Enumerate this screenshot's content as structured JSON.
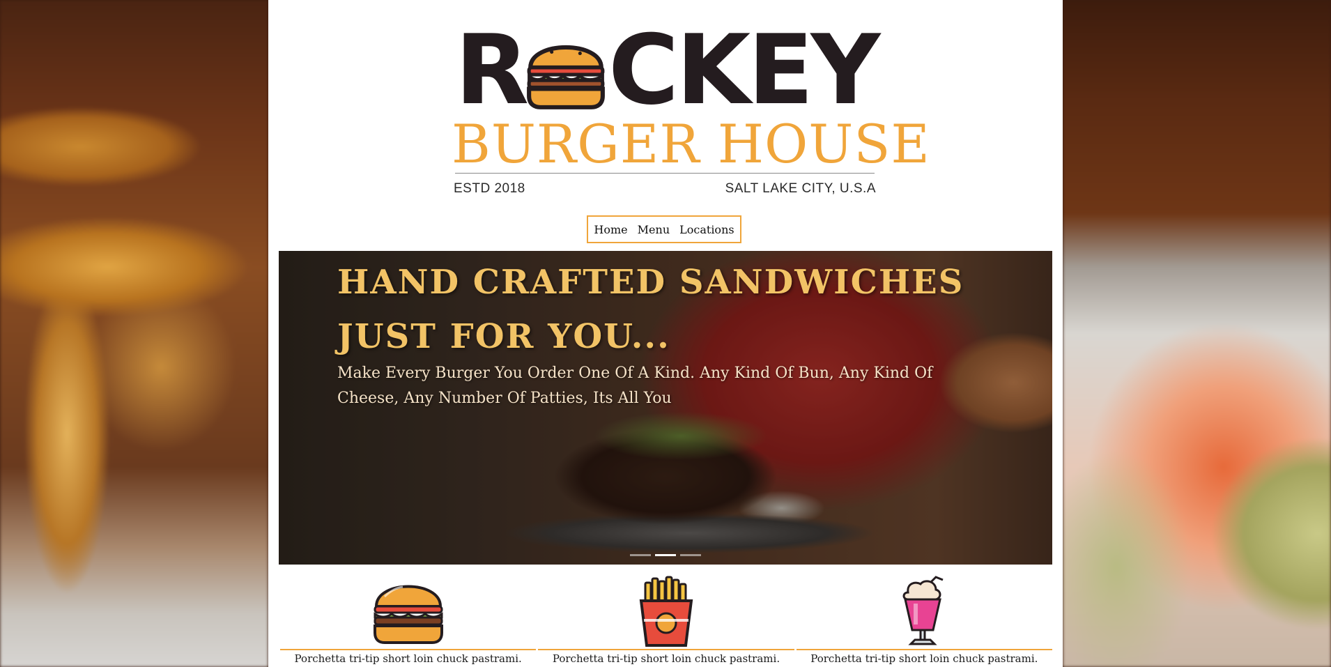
{
  "brand": {
    "name_top_first": "R",
    "name_top_rest": "CKEY",
    "name_sub": "BURGER HOUSE",
    "established": "ESTD 2018",
    "location": "SALT LAKE CITY, U.S.A"
  },
  "nav": {
    "items": [
      {
        "label": "Home"
      },
      {
        "label": "Menu"
      },
      {
        "label": "Locations"
      }
    ]
  },
  "hero": {
    "title": "HAND CRAFTED SANDWICHES JUST FOR YOU...",
    "subtitle": "Make Every Burger You Order One Of A Kind. Any Kind Of Bun, Any Kind Of Cheese, Any Number Of Patties, Its All You",
    "slides": 3,
    "active_slide": 2
  },
  "features": [
    {
      "icon": "burger-icon",
      "caption": "Porchetta tri-tip short loin chuck pastrami."
    },
    {
      "icon": "fries-icon",
      "caption": "Porchetta tri-tip short loin chuck pastrami."
    },
    {
      "icon": "milkshake-icon",
      "caption": "Porchetta tri-tip short loin chuck pastrami."
    }
  ],
  "colors": {
    "accent": "#f0a53a",
    "logo_dark": "#241c1f",
    "hero_title": "#f2c366"
  }
}
